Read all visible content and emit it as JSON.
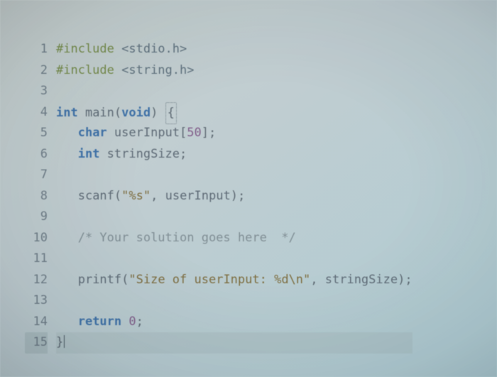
{
  "editor": {
    "language": "c",
    "cursor_line": 15,
    "tab_size": 3,
    "lines": [
      {
        "n": 1,
        "text": "#include <stdio.h>"
      },
      {
        "n": 2,
        "text": "#include <string.h>"
      },
      {
        "n": 3,
        "text": ""
      },
      {
        "n": 4,
        "text": "int main(void) {"
      },
      {
        "n": 5,
        "text": "   char userInput[50];"
      },
      {
        "n": 6,
        "text": "   int stringSize;"
      },
      {
        "n": 7,
        "text": ""
      },
      {
        "n": 8,
        "text": "   scanf(\"%s\", userInput);"
      },
      {
        "n": 9,
        "text": ""
      },
      {
        "n": 10,
        "text": "   /* Your solution goes here  */"
      },
      {
        "n": 11,
        "text": ""
      },
      {
        "n": 12,
        "text": "   printf(\"Size of userInput: %d\\n\", stringSize);"
      },
      {
        "n": 13,
        "text": ""
      },
      {
        "n": 14,
        "text": "   return 0;"
      },
      {
        "n": 15,
        "text": "}"
      }
    ],
    "tokens": {
      "1": [
        [
          "pp",
          "#include "
        ],
        [
          "ang",
          "<stdio.h>"
        ]
      ],
      "2": [
        [
          "pp",
          "#include "
        ],
        [
          "ang",
          "<string.h>"
        ]
      ],
      "3": [],
      "4": [
        [
          "type",
          "int "
        ],
        [
          "fn",
          "main"
        ],
        [
          "punc",
          "("
        ],
        [
          "kw",
          "void"
        ],
        [
          "punc",
          ") "
        ],
        [
          "brace",
          "{"
        ]
      ],
      "5": [
        [
          "plain",
          "   "
        ],
        [
          "type",
          "char "
        ],
        [
          "name",
          "userInput"
        ],
        [
          "punc",
          "["
        ],
        [
          "num",
          "50"
        ],
        [
          "punc",
          "];"
        ]
      ],
      "6": [
        [
          "plain",
          "   "
        ],
        [
          "type",
          "int "
        ],
        [
          "name",
          "stringSize"
        ],
        [
          "punc",
          ";"
        ]
      ],
      "7": [],
      "8": [
        [
          "plain",
          "   "
        ],
        [
          "fn",
          "scanf"
        ],
        [
          "punc",
          "("
        ],
        [
          "str",
          "\"%s\""
        ],
        [
          "punc",
          ", "
        ],
        [
          "name",
          "userInput"
        ],
        [
          "punc",
          ");"
        ]
      ],
      "9": [],
      "10": [
        [
          "plain",
          "   "
        ],
        [
          "cmt",
          "/* Your solution goes here  */"
        ]
      ],
      "11": [],
      "12": [
        [
          "plain",
          "   "
        ],
        [
          "fn",
          "printf"
        ],
        [
          "punc",
          "("
        ],
        [
          "str",
          "\"Size of userInput: %d\\n\""
        ],
        [
          "punc",
          ", "
        ],
        [
          "name",
          "stringSize"
        ],
        [
          "punc",
          ");"
        ]
      ],
      "13": [],
      "14": [
        [
          "plain",
          "   "
        ],
        [
          "kw",
          "return "
        ],
        [
          "num",
          "0"
        ],
        [
          "punc",
          ";"
        ]
      ],
      "15": [
        [
          "punc",
          "}"
        ],
        [
          "cursor",
          ""
        ]
      ]
    }
  }
}
